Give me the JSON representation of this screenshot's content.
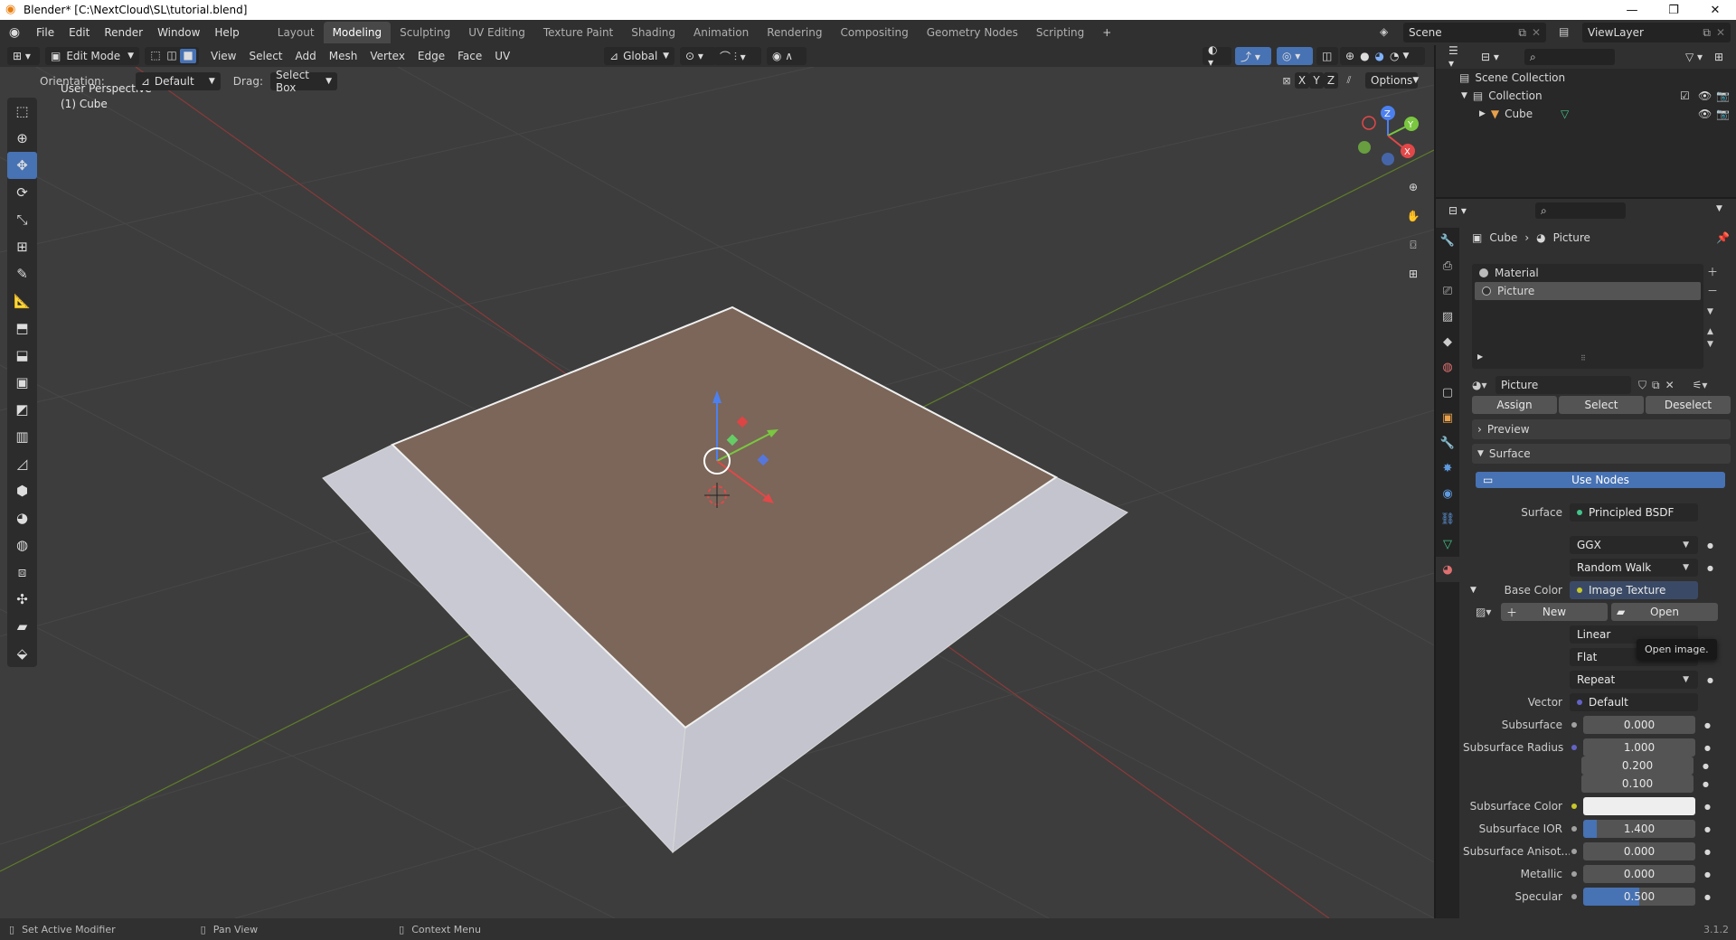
{
  "window": {
    "title": "Blender* [C:\\NextCloud\\SL\\tutorial.blend]"
  },
  "menu": [
    "File",
    "Edit",
    "Render",
    "Window",
    "Help"
  ],
  "workspaces": {
    "items": [
      "Layout",
      "Modeling",
      "Sculpting",
      "UV Editing",
      "Texture Paint",
      "Shading",
      "Animation",
      "Rendering",
      "Compositing",
      "Geometry Nodes",
      "Scripting"
    ],
    "active": "Modeling"
  },
  "scene": {
    "name": "Scene",
    "view_layer": "ViewLayer"
  },
  "viewport_header": {
    "mode": "Edit Mode",
    "menus": [
      "View",
      "Select",
      "Add",
      "Mesh",
      "Vertex",
      "Edge",
      "Face",
      "UV"
    ],
    "transform_orientation": "Global",
    "orientation_label": "Orientation:",
    "orientation_value": "Default",
    "drag_label": "Drag:",
    "drag_value": "Select Box",
    "axes": [
      "X",
      "Y",
      "Z"
    ],
    "options": "Options"
  },
  "viewport": {
    "view_name": "User Perspective",
    "object_name": "(1) Cube"
  },
  "outliner": {
    "scene_collection": "Scene Collection",
    "collection": "Collection",
    "object": "Cube"
  },
  "properties": {
    "breadcrumb": {
      "object": "Cube",
      "material": "Picture"
    },
    "material_slots": [
      "Material",
      "Picture"
    ],
    "active_slot": "Picture",
    "material_name": "Picture",
    "buttons": {
      "assign": "Assign",
      "select": "Select",
      "deselect": "Deselect"
    },
    "panels": {
      "preview": "Preview",
      "surface": "Surface"
    },
    "use_nodes": "Use Nodes",
    "surface_label": "Surface",
    "surface_value": "Principled BSDF",
    "distribution": "GGX",
    "subsurface_method": "Random Walk",
    "base_color_label": "Base Color",
    "base_color_value": "Image Texture",
    "image_new": "New",
    "image_open": "Open",
    "tooltip": "Open image.",
    "interpolation": "Linear",
    "projection": "Flat",
    "extension": "Repeat",
    "vector_label": "Vector",
    "vector_value": "Default",
    "rows": [
      {
        "label": "Subsurface",
        "value": "0.000"
      },
      {
        "label": "Subsurface Radius",
        "value": "1.000"
      },
      {
        "label": "",
        "value": "0.200"
      },
      {
        "label": "",
        "value": "0.100"
      },
      {
        "label": "Subsurface Color",
        "value": ""
      },
      {
        "label": "Subsurface IOR",
        "value": "1.400"
      },
      {
        "label": "Subsurface Anisot...",
        "value": "0.000"
      },
      {
        "label": "Metallic",
        "value": "0.000"
      },
      {
        "label": "Specular",
        "value": "0.500"
      }
    ]
  },
  "statusbar": {
    "left": "Set Active Modifier",
    "middle": "Pan View",
    "right": "Context Menu",
    "version": "3.1.2"
  },
  "colors": {
    "accent": "#4772b3",
    "face_selected": "#7a6559",
    "socket_yellow": "#c7c729",
    "socket_grey": "#a1a1a1",
    "socket_blue": "#6363c7"
  },
  "icons": [
    "blender-logo-icon",
    "scene-icon",
    "viewlayer-icon",
    "search-icon",
    "filter-icon",
    "eye-icon",
    "camera-icon",
    "checkbox-icon",
    "zoom-icon",
    "hand-icon",
    "camera-view-icon",
    "grid-icon",
    "material-icon",
    "pin-icon",
    "plus-icon",
    "minus-icon",
    "folder-icon",
    "image-icon",
    "chevron-down-icon"
  ]
}
